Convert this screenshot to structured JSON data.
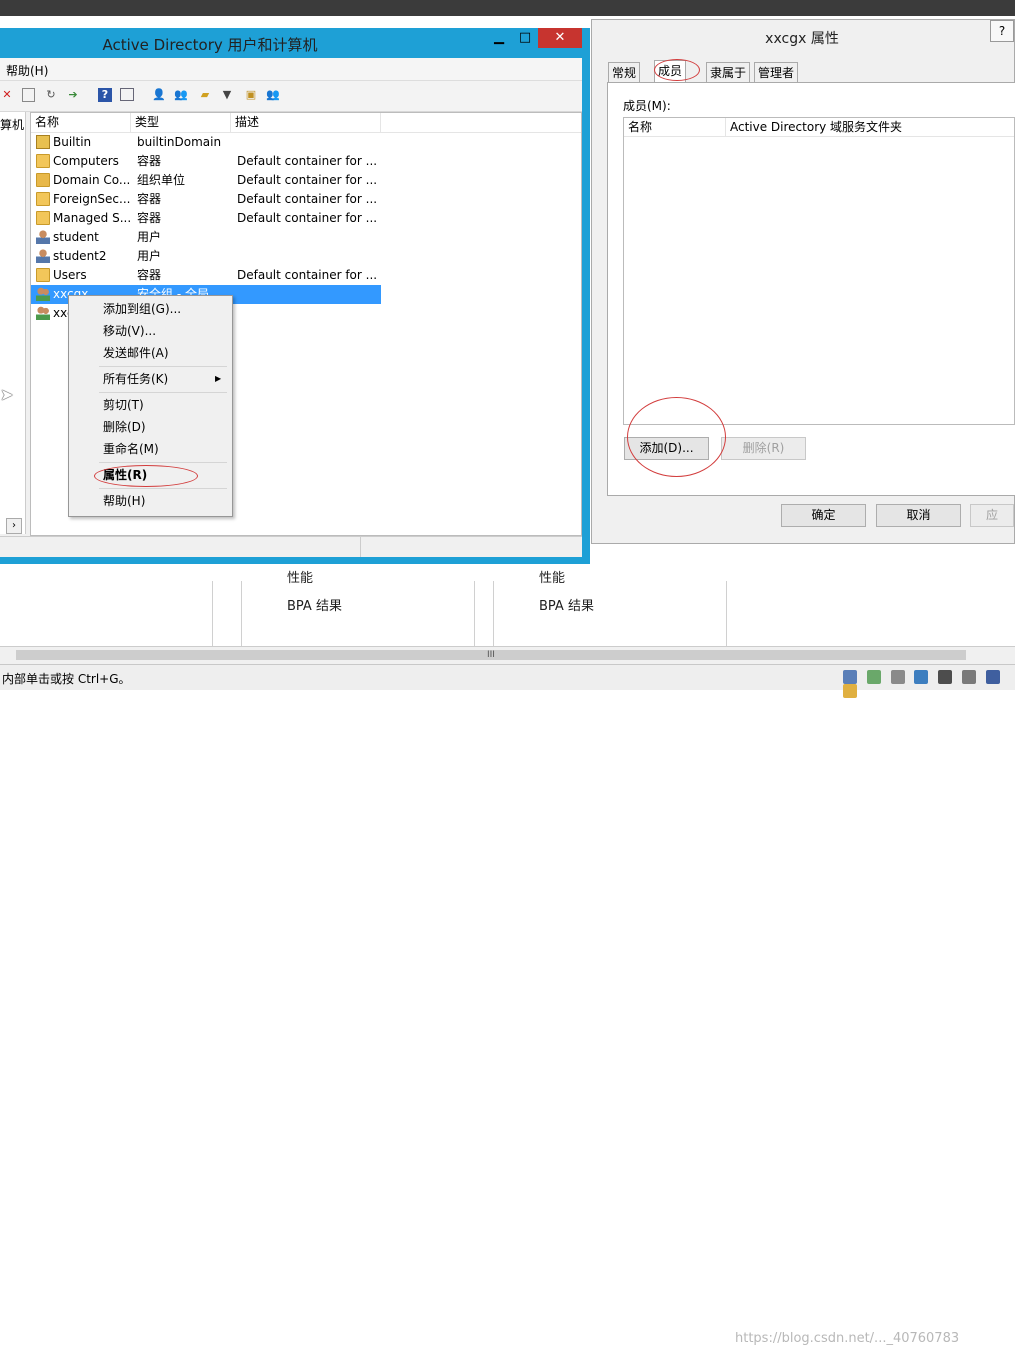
{
  "background": {
    "perf_1": "性能",
    "bpa_1": "BPA 结果",
    "perf_2": "性能",
    "bpa_2": "BPA 结果",
    "scroll_grip": "III"
  },
  "status_bar": {
    "text": "内部单击或按 Ctrl+G。",
    "watermark": "https://blog.csdn.net/..._40760783"
  },
  "aduc": {
    "title": "Active Directory 用户和计算机",
    "menu_help": "帮助(H)",
    "tree_label": "算机",
    "columns": [
      "名称",
      "类型",
      "描述"
    ],
    "rows": [
      {
        "name": "Builtin",
        "type": "builtinDomain",
        "desc": "",
        "icon": "domain-icon"
      },
      {
        "name": "Computers",
        "type": "容器",
        "desc": "Default container for ...",
        "icon": "folder-icon"
      },
      {
        "name": "Domain Co...",
        "type": "组织单位",
        "desc": "Default container for ...",
        "icon": "ou-folder-icon"
      },
      {
        "name": "ForeignSec...",
        "type": "容器",
        "desc": "Default container for ...",
        "icon": "folder-icon"
      },
      {
        "name": "Managed S...",
        "type": "容器",
        "desc": "Default container for ...",
        "icon": "folder-icon"
      },
      {
        "name": "student",
        "type": "用户",
        "desc": "",
        "icon": "user-icon"
      },
      {
        "name": "student2",
        "type": "用户",
        "desc": "",
        "icon": "user-icon"
      },
      {
        "name": "Users",
        "type": "容器",
        "desc": "Default container for ...",
        "icon": "folder-icon"
      },
      {
        "name": "xxcgx",
        "type": "安全组 - 全局",
        "desc": "",
        "icon": "group-icon"
      },
      {
        "name": "xxc",
        "type": "",
        "desc": "",
        "icon": "group-icon"
      }
    ]
  },
  "context_menu": {
    "items": [
      "添加到组(G)...",
      "移动(V)...",
      "发送邮件(A)",
      "所有任务(K)",
      "剪切(T)",
      "删除(D)",
      "重命名(M)",
      "属性(R)",
      "帮助(H)"
    ]
  },
  "properties": {
    "title": "xxcgx 属性",
    "help_button": "?",
    "tabs": [
      "常规",
      "成员",
      "隶属于",
      "管理者"
    ],
    "members_label": "成员(M):",
    "member_columns": [
      "名称",
      "Active Directory 域服务文件夹"
    ],
    "add_button": "添加(D)...",
    "remove_button": "删除(R)",
    "ok_button": "确定",
    "cancel_button": "取消",
    "apply_button": "应"
  },
  "colors": {
    "aduc_border": "#1ea0d6",
    "close_button": "#c7342f",
    "selection": "#3399ff",
    "annotation_red": "#d23c3c"
  }
}
